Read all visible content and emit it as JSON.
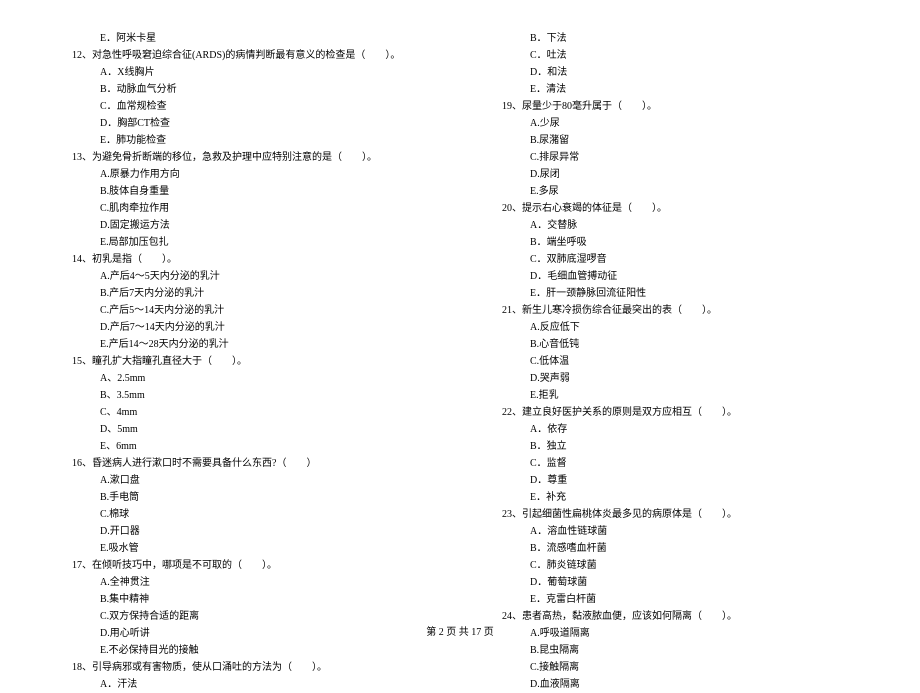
{
  "leftColumn": [
    {
      "type": "option",
      "text": "E．阿米卡星"
    },
    {
      "type": "question",
      "text": "12、对急性呼吸窘迫综合征(ARDS)的病情判断最有意义的检查是（　　）。"
    },
    {
      "type": "option",
      "text": "A．X线胸片"
    },
    {
      "type": "option",
      "text": "B．动脉血气分析"
    },
    {
      "type": "option",
      "text": "C．血常规检查"
    },
    {
      "type": "option",
      "text": "D．胸部CT检查"
    },
    {
      "type": "option",
      "text": "E．肺功能检查"
    },
    {
      "type": "question",
      "text": "13、为避免骨折断端的移位，急救及护理中应特别注意的是（　　）。"
    },
    {
      "type": "option",
      "text": "A.原暴力作用方向"
    },
    {
      "type": "option",
      "text": "B.肢体自身重量"
    },
    {
      "type": "option",
      "text": "C.肌肉牵拉作用"
    },
    {
      "type": "option",
      "text": "D.固定搬运方法"
    },
    {
      "type": "option",
      "text": "E.局部加压包扎"
    },
    {
      "type": "question",
      "text": "14、初乳是指（　　）。"
    },
    {
      "type": "option",
      "text": "A.产后4～5天内分泌的乳汁"
    },
    {
      "type": "option",
      "text": "B.产后7天内分泌的乳汁"
    },
    {
      "type": "option",
      "text": "C.产后5～14天内分泌的乳汁"
    },
    {
      "type": "option",
      "text": "D.产后7～14天内分泌的乳汁"
    },
    {
      "type": "option",
      "text": "E.产后14～28天内分泌的乳汁"
    },
    {
      "type": "question",
      "text": "15、瞳孔扩大指瞳孔直径大于（　　）。"
    },
    {
      "type": "option",
      "text": "A、2.5mm"
    },
    {
      "type": "option",
      "text": "B、3.5mm"
    },
    {
      "type": "option",
      "text": "C、4mm"
    },
    {
      "type": "option",
      "text": "D、5mm"
    },
    {
      "type": "option",
      "text": "E、6mm"
    },
    {
      "type": "question",
      "text": "16、昏迷病人进行漱口时不需要具备什么东西?（　　）"
    },
    {
      "type": "option",
      "text": "A.漱口盘"
    },
    {
      "type": "option",
      "text": "B.手电筒"
    },
    {
      "type": "option",
      "text": "C.棉球"
    },
    {
      "type": "option",
      "text": "D.开口器"
    },
    {
      "type": "option",
      "text": "E.吸水管"
    },
    {
      "type": "question",
      "text": "17、在倾听技巧中，哪项是不可取的（　　）。"
    },
    {
      "type": "option",
      "text": "A.全神贯注"
    },
    {
      "type": "option",
      "text": "B.集中精神"
    },
    {
      "type": "option",
      "text": "C.双方保持合适的距离"
    },
    {
      "type": "option",
      "text": "D.用心听讲"
    },
    {
      "type": "option",
      "text": "E.不必保持目光的接触"
    },
    {
      "type": "question",
      "text": "18、引导病邪或有害物质，使从口涌吐的方法为（　　）。"
    },
    {
      "type": "option",
      "text": "A．汗法"
    }
  ],
  "rightColumn": [
    {
      "type": "option",
      "text": "B．下法"
    },
    {
      "type": "option",
      "text": "C．吐法"
    },
    {
      "type": "option",
      "text": "D．和法"
    },
    {
      "type": "option",
      "text": "E．清法"
    },
    {
      "type": "question",
      "text": "19、尿量少于80毫升属于（　　）。"
    },
    {
      "type": "option",
      "text": "A.少尿"
    },
    {
      "type": "option",
      "text": "B.尿潴留"
    },
    {
      "type": "option",
      "text": "C.排尿异常"
    },
    {
      "type": "option",
      "text": "D.尿闭"
    },
    {
      "type": "option",
      "text": "E.多尿"
    },
    {
      "type": "question",
      "text": "20、提示右心衰竭的体征是（　　）。"
    },
    {
      "type": "option",
      "text": "A．交替脉"
    },
    {
      "type": "option",
      "text": "B．端坐呼吸"
    },
    {
      "type": "option",
      "text": "C．双肺底湿啰音"
    },
    {
      "type": "option",
      "text": "D．毛细血管搏动征"
    },
    {
      "type": "option",
      "text": "E．肝一颈静脉回流征阳性"
    },
    {
      "type": "question",
      "text": "21、新生儿寒冷损伤综合征最突出的表（　　）。"
    },
    {
      "type": "option",
      "text": "A.反应低下"
    },
    {
      "type": "option",
      "text": "B.心音低钝"
    },
    {
      "type": "option",
      "text": "C.低体温"
    },
    {
      "type": "option",
      "text": "D.哭声弱"
    },
    {
      "type": "option",
      "text": "E.拒乳"
    },
    {
      "type": "question",
      "text": "22、建立良好医护关系的原则是双方应相互（　　）。"
    },
    {
      "type": "option",
      "text": "A．依存"
    },
    {
      "type": "option",
      "text": "B．独立"
    },
    {
      "type": "option",
      "text": "C．监督"
    },
    {
      "type": "option",
      "text": "D．尊重"
    },
    {
      "type": "option",
      "text": "E．补充"
    },
    {
      "type": "question",
      "text": "23、引起细菌性扁桃体炎最多见的病原体是（　　）。"
    },
    {
      "type": "option",
      "text": "A．溶血性链球菌"
    },
    {
      "type": "option",
      "text": "B．流感嗜血杆菌"
    },
    {
      "type": "option",
      "text": "C．肺炎链球菌"
    },
    {
      "type": "option",
      "text": "D．葡萄球菌"
    },
    {
      "type": "option",
      "text": "E．克雷白杆菌"
    },
    {
      "type": "question",
      "text": "24、患者高热，黏液脓血便，应该如何隔离（　　）。"
    },
    {
      "type": "option",
      "text": "A.呼吸道隔离"
    },
    {
      "type": "option",
      "text": "B.昆虫隔离"
    },
    {
      "type": "option",
      "text": "C.接触隔离"
    },
    {
      "type": "option",
      "text": "D.血液隔离"
    }
  ],
  "footer": "第 2 页 共 17 页"
}
